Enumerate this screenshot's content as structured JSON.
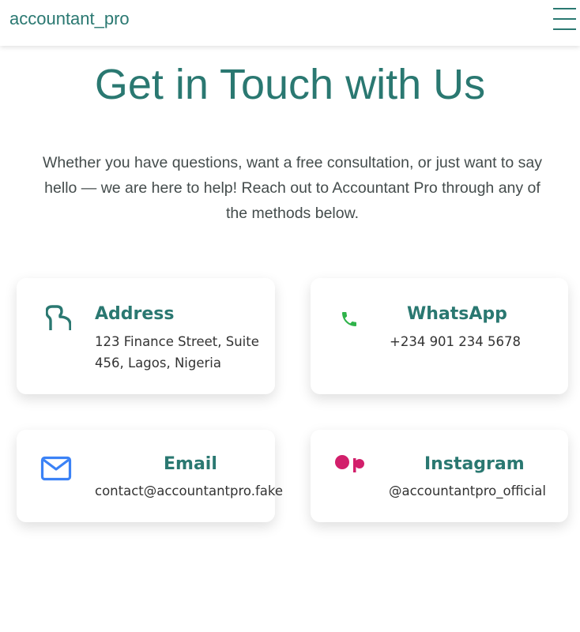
{
  "nav": {
    "brand": "accountant_pro",
    "menu_icon": "hamburger-menu-icon"
  },
  "hero": {
    "title": "Get in Touch with Us",
    "intro": "Whether you have questions, want a free consultation, or just want to say hello — we are here to help! Reach out to Accountant Pro through any of the methods below."
  },
  "cards": {
    "address": {
      "icon": "location-icon",
      "title": "Address",
      "line1": "123 Finance Street, Suite",
      "line2": "456, Lagos, Nigeria"
    },
    "whatsapp": {
      "icon": "phone-icon",
      "title": "WhatsApp",
      "text": "+234 901 234 5678"
    },
    "email": {
      "icon": "envelope-icon",
      "title": "Email",
      "text": "contact@accountantpro.fake"
    },
    "instagram": {
      "icon": "patreon-style-icon",
      "title": "Instagram",
      "text": "@accountantpro_official"
    }
  },
  "colors": {
    "brand": "#2a7871",
    "whatsapp_green": "#2fb34a",
    "email_blue": "#3b82f6",
    "instagram_pink": "#d21f6b"
  }
}
